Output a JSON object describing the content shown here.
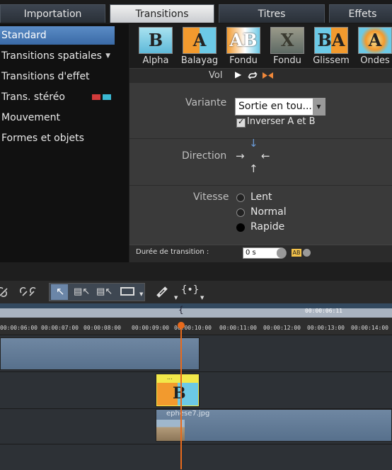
{
  "tabs": [
    "Importation",
    "Transitions",
    "Titres",
    "Effets"
  ],
  "categories": [
    {
      "label": "Standard"
    },
    {
      "label": "Transitions spatiales"
    },
    {
      "label": "Transitions d'effet"
    },
    {
      "label": "Trans. stéréo"
    },
    {
      "label": "Mouvement"
    },
    {
      "label": "Formes et objets"
    }
  ],
  "thumbnails": [
    {
      "label": "Alpha",
      "glyph": "B"
    },
    {
      "label": "Balayag",
      "glyph": "A"
    },
    {
      "label": "Fondu",
      "glyph": "AB"
    },
    {
      "label": "Fondu",
      "glyph": "X"
    },
    {
      "label": "Glissem",
      "glyph": "BA"
    },
    {
      "label": "Ondes",
      "glyph": "A"
    }
  ],
  "controls": {
    "vol_label": "Vol"
  },
  "variante": {
    "label": "Variante",
    "value": "Sortie en tou...",
    "invert_label": "Inverser A et B"
  },
  "direction": {
    "label": "Direction"
  },
  "vitesse": {
    "label": "Vitesse",
    "options": [
      "Lent",
      "Normal",
      "Rapide"
    ],
    "selected": "Rapide"
  },
  "duration": {
    "label": "Durée de transition :",
    "value": "0 s"
  },
  "timeline": {
    "timecode": "00:00:06:11",
    "ticks": [
      "00:00:06:00",
      "00:00:07:00",
      "00:00:08:00",
      "00:00:09:00",
      "00:00:10:00",
      "00:00:11:00",
      "00:00:12:00",
      "00:00:13:00",
      "00:00:14:00"
    ],
    "clip_name": "ephese7.jpg",
    "transition_label": "..."
  }
}
